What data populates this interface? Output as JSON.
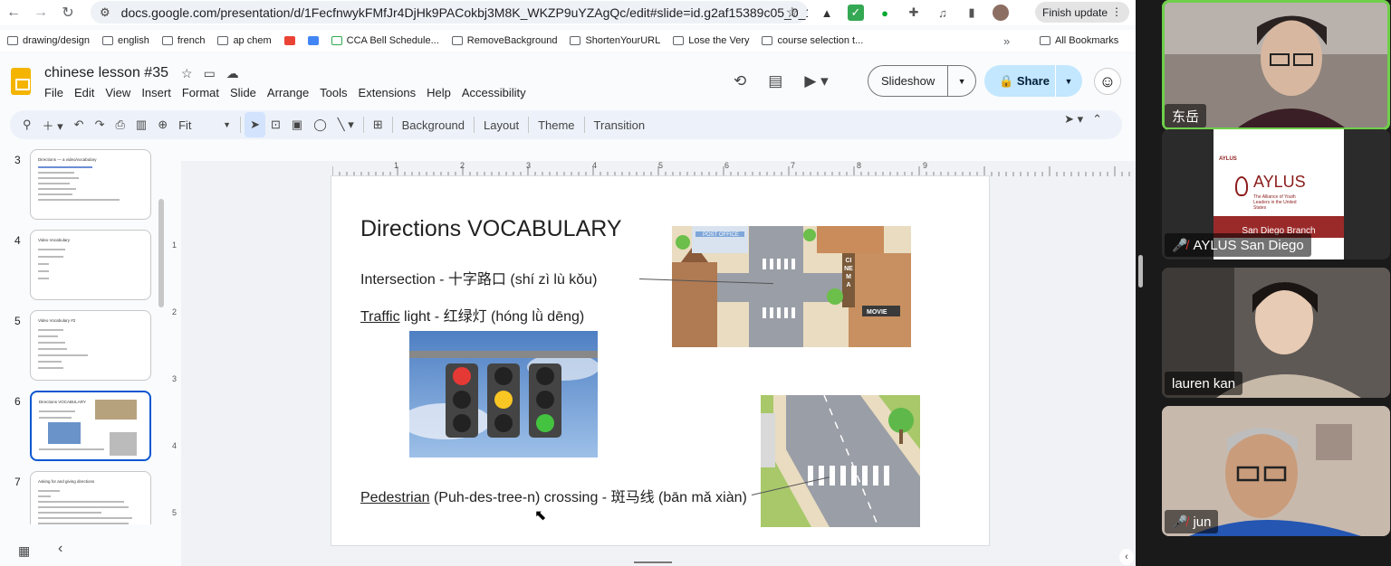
{
  "browser": {
    "url": "docs.google.com/presentation/d/1FecfnwykFMfJr4DjHk9PACokbj3M8K_WKZP9uYZAgQc/edit#slide=id.g2af15389c05_0_15",
    "finish_update": "Finish update",
    "bookmarks": [
      "drawing/design",
      "english",
      "french",
      "ap chem",
      "",
      "",
      "CCA Bell Schedule...",
      "RemoveBackground",
      "ShortenYourURL",
      "Lose the Very",
      "course selection t..."
    ],
    "all_bookmarks": "All Bookmarks"
  },
  "app": {
    "doc_title": "chinese lesson #35",
    "menu": [
      "File",
      "Edit",
      "View",
      "Insert",
      "Format",
      "Slide",
      "Arrange",
      "Tools",
      "Extensions",
      "Help",
      "Accessibility"
    ],
    "slideshow_label": "Slideshow",
    "share_label": "Share",
    "toolbar": {
      "zoom": "Fit",
      "background": "Background",
      "layout": "Layout",
      "theme": "Theme",
      "transition": "Transition"
    }
  },
  "filmstrip": [
    {
      "num": "3",
      "title": "Directions — a video/vocabulary"
    },
    {
      "num": "4",
      "title": "Video Vocabulary"
    },
    {
      "num": "5",
      "title": "Video Vocabulary #2"
    },
    {
      "num": "6",
      "title": "Directions VOCABULARY",
      "active": true
    },
    {
      "num": "7",
      "title": "Asking for and giving directions"
    }
  ],
  "ruler": {
    "h": [
      "1",
      "2",
      "3",
      "4",
      "5",
      "6",
      "7",
      "8",
      "9"
    ],
    "v": [
      "1",
      "2",
      "3",
      "4",
      "5"
    ]
  },
  "slide": {
    "title": "Directions VOCABULARY",
    "intersection": "Intersection - 十字路口 (shí zì lù kǒu)",
    "traffic_word": "Traffic",
    "traffic_rest": " light - 红绿灯 (hóng lǜ dēng)",
    "pedestrian_word": "Pedestrian",
    "pedestrian_rest": " (Puh-des-tree-n) crossing - 斑马线 (bān mǎ xiàn)",
    "img_labels": {
      "post_office": "POST OFFICE",
      "cinema": "CINEMA",
      "movie": "MOVIE"
    }
  },
  "participants": [
    {
      "name": "东岳",
      "muted": false,
      "speaking": true
    },
    {
      "name": "AYLUS San Diego",
      "muted": true,
      "speaking": false
    },
    {
      "name": "lauren kan",
      "muted": false,
      "speaking": false
    },
    {
      "name": "jun",
      "muted": true,
      "speaking": false
    }
  ],
  "aylus": {
    "brand": "AYLUS",
    "tagline": "The Alliance of Youth Leaders in the United States",
    "branch": "San Diego Branch"
  }
}
